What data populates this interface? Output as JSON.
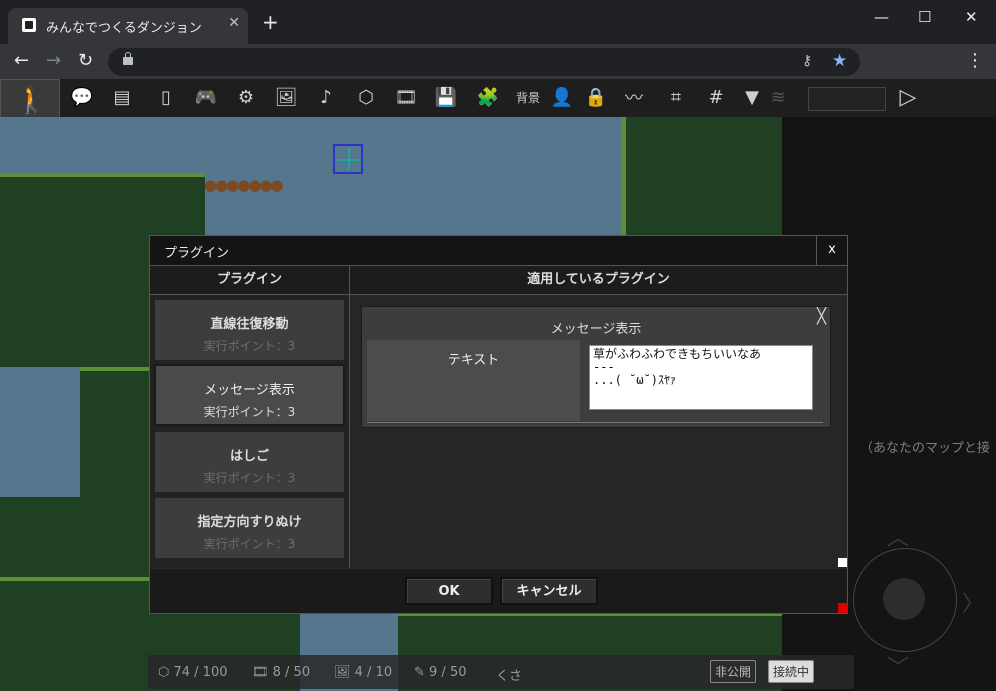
{
  "browser": {
    "tab_title": "みんなでつくるダンジョン",
    "tab_close": "✕",
    "new_tab": "+",
    "window": {
      "minimize": "—",
      "maximize": "☐",
      "close": "✕"
    },
    "nav": {
      "back": "←",
      "forward": "→",
      "reload": "↻"
    },
    "menu": "⋮",
    "key_icon": "⚷",
    "star_icon": "★"
  },
  "app_toolbar": {
    "player_icon": "🚶",
    "tools": [
      {
        "name": "speech-bubble-icon",
        "glyph": "💬"
      },
      {
        "name": "layers-icon",
        "glyph": "▤"
      },
      {
        "name": "door-icon",
        "glyph": "▯"
      },
      {
        "name": "gamepad-icon",
        "glyph": "🎮"
      },
      {
        "name": "gear-icon",
        "glyph": "⚙"
      },
      {
        "name": "image-icon",
        "glyph": "🖼"
      },
      {
        "name": "music-note-icon",
        "glyph": "♪"
      },
      {
        "name": "cube-icon",
        "glyph": "⬡"
      },
      {
        "name": "film-icon",
        "glyph": "🎞"
      },
      {
        "name": "save-icon",
        "glyph": "💾"
      },
      {
        "name": "plugin-icon",
        "glyph": "🧩"
      },
      {
        "name": "background-label",
        "glyph": "背景"
      },
      {
        "name": "person-icon",
        "glyph": "👤"
      },
      {
        "name": "lock-icon",
        "glyph": "🔒"
      },
      {
        "name": "path-icon",
        "glyph": "〰"
      },
      {
        "name": "select-grid-icon",
        "glyph": "⌗"
      },
      {
        "name": "grid-icon",
        "glyph": "#"
      },
      {
        "name": "dropdown-icon",
        "glyph": "▼"
      },
      {
        "name": "stack-icon",
        "glyph": "≋"
      }
    ],
    "play_icon": "▷"
  },
  "side_note": "（あなたのマップと接",
  "status_bar": {
    "blocks": "74 / 100",
    "frames": "8 / 50",
    "images": "4 / 10",
    "plugins": "9 / 50",
    "extra": "くさ",
    "private_label": "非公開",
    "connecting_label": "接続中"
  },
  "dialog": {
    "title": "プラグイン",
    "close": "x",
    "left_header": "プラグイン",
    "right_header": "適用しているプラグイン",
    "plugins": [
      {
        "name": "直線往復移動",
        "points": "実行ポイント：3",
        "selected": false
      },
      {
        "name": "メッセージ表示",
        "points": "実行ポイント：3",
        "selected": true
      },
      {
        "name": "はしご",
        "points": "実行ポイント：3",
        "selected": false
      },
      {
        "name": "指定方向すりぬけ",
        "points": "実行ポイント：3",
        "selected": false
      }
    ],
    "applied": {
      "title": "メッセージ表示",
      "close": "╳",
      "field_label": "テキスト",
      "field_value": "草がふわふわできもちいいなあ\n---\n...( ˘ω˘)ｽﾔｧ"
    },
    "ok_label": "OK",
    "cancel_label": "キャンセル"
  },
  "colors": {
    "sky": "#54778d",
    "grass_dark": "#1f4023",
    "grass_light": "#5d8f36",
    "accent_red": "#e00000"
  }
}
